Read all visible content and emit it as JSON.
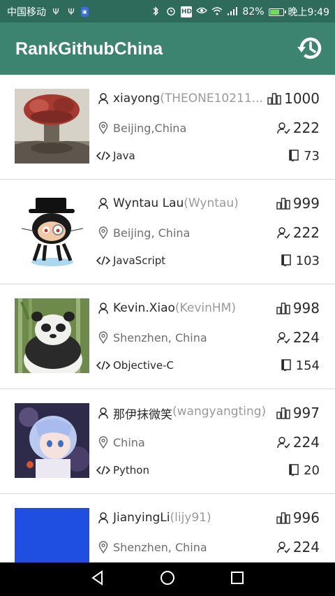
{
  "status_bar": {
    "carrier": "中国移动",
    "battery": "82%",
    "battery_level": 0.82,
    "time": "晚上9:49",
    "icons": [
      "usb-icon",
      "usb-icon",
      "app-badge-icon",
      "bluetooth-icon",
      "alarm-icon",
      "hd-icon",
      "eye-icon",
      "wifi-icon",
      "signal-icon",
      "battery-icon"
    ]
  },
  "app_bar": {
    "title": "RankGithubChina",
    "action_icon": "history-icon"
  },
  "users": [
    {
      "name": "xiayong",
      "login": "(THEONE10211...",
      "location": "Beijing,China",
      "language": "Java",
      "rank": "1000",
      "followers": "222",
      "repos": "73",
      "avatar": "mushroom-cloud"
    },
    {
      "name": "Wyntau Lau",
      "login": "(Wyntau)",
      "location": "Beijing, China",
      "language": "JavaScript",
      "rank": "999",
      "followers": "222",
      "repos": "103",
      "avatar": "octocat"
    },
    {
      "name": "Kevin.Xiao",
      "login": "(KevinHM)",
      "location": "Shenzhen, China",
      "language": "Objective-C",
      "rank": "998",
      "followers": "224",
      "repos": "154",
      "avatar": "panda"
    },
    {
      "name": "那伊抹微笑",
      "login": "(wangyangting)",
      "location": "China",
      "language": "Python",
      "rank": "997",
      "followers": "224",
      "repos": "20",
      "avatar": "anime-girl"
    },
    {
      "name": "JianyingLi",
      "login": "(lijy91)",
      "location": "Shenzhen, China",
      "language": "",
      "rank": "996",
      "followers": "224",
      "repos": "",
      "avatar": "blue-square"
    }
  ],
  "nav_bar": {
    "buttons": [
      "back-icon",
      "home-icon",
      "recents-icon"
    ]
  },
  "colors": {
    "status_bar": "#2e6b5a",
    "app_bar": "#3d8470",
    "text_primary": "#2a2a2a",
    "text_secondary": "#9a9a9a"
  }
}
